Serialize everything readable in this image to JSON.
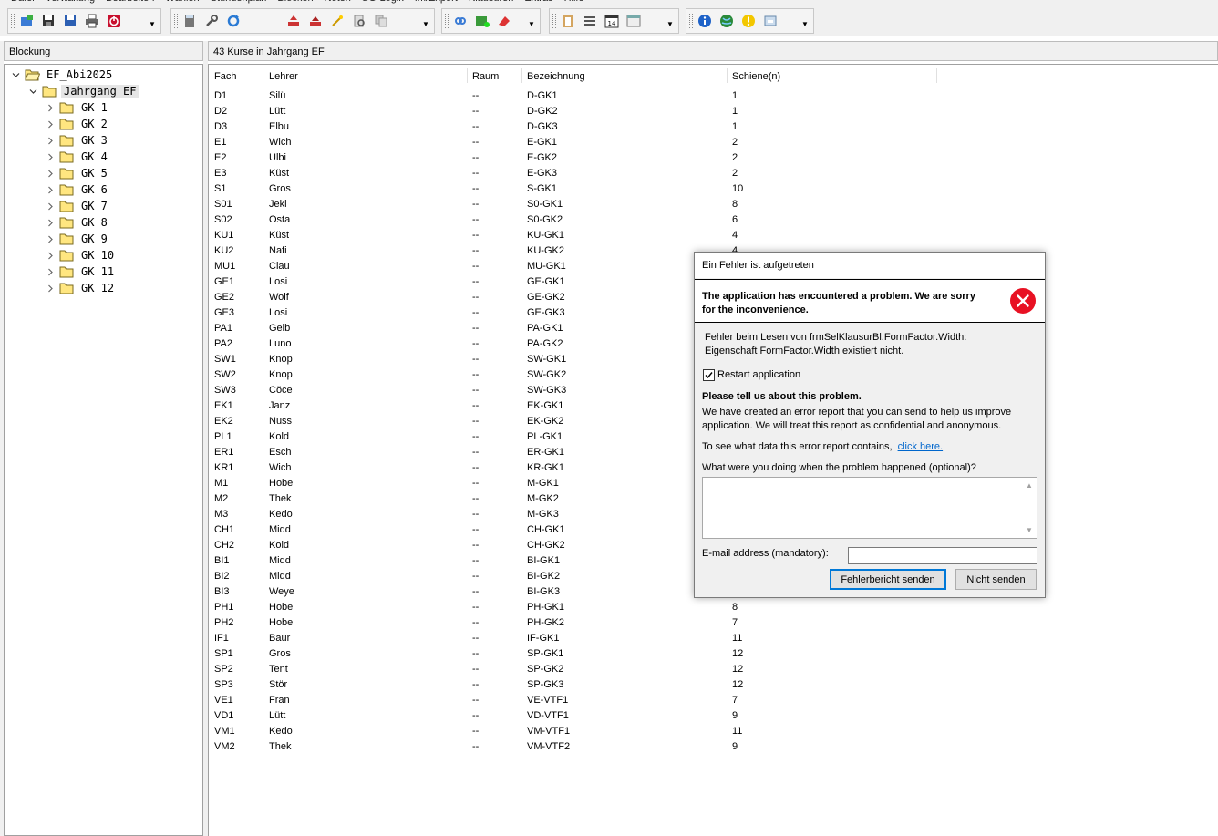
{
  "menu": [
    "Datei",
    "Verwaltung",
    "Bearbeiten",
    "Wählen",
    "Stundenplan",
    "Blocken",
    "Noten",
    "SG-Logik",
    "Im/Export",
    "Klausuren",
    "Extras",
    "Hilfe"
  ],
  "left_panel": {
    "title": "Blockung"
  },
  "right_panel": {
    "title": "43 Kurse in Jahrgang EF"
  },
  "tree": {
    "root": "EF_Abi2025",
    "group": "Jahrgang EF",
    "items": [
      "GK 1",
      "GK 2",
      "GK 3",
      "GK 4",
      "GK 5",
      "GK 6",
      "GK 7",
      "GK 8",
      "GK 9",
      "GK 10",
      "GK 11",
      "GK 12"
    ]
  },
  "table": {
    "columns": [
      "Fach",
      "Lehrer",
      "Raum",
      "Bezeichnung",
      "Schiene(n)"
    ],
    "rows": [
      [
        "D1",
        "Silü",
        "--",
        "D-GK1",
        "1"
      ],
      [
        "D2",
        "Lütt",
        "--",
        "D-GK2",
        "1"
      ],
      [
        "D3",
        "Elbu",
        "--",
        "D-GK3",
        "1"
      ],
      [
        "E1",
        "Wich",
        "--",
        "E-GK1",
        "2"
      ],
      [
        "E2",
        "Ulbi",
        "--",
        "E-GK2",
        "2"
      ],
      [
        "E3",
        "Küst",
        "--",
        "E-GK3",
        "2"
      ],
      [
        "S1",
        "Gros",
        "--",
        "S-GK1",
        "10"
      ],
      [
        "S01",
        "Jeki",
        "--",
        "S0-GK1",
        "8"
      ],
      [
        "S02",
        "Osta",
        "--",
        "S0-GK2",
        "6"
      ],
      [
        "KU1",
        "Küst",
        "--",
        "KU-GK1",
        "4"
      ],
      [
        "KU2",
        "Nafi",
        "--",
        "KU-GK2",
        "4"
      ],
      [
        "MU1",
        "Clau",
        "--",
        "MU-GK1",
        ""
      ],
      [
        "GE1",
        "Losi",
        "--",
        "GE-GK1",
        ""
      ],
      [
        "GE2",
        "Wolf",
        "--",
        "GE-GK2",
        ""
      ],
      [
        "GE3",
        "Losi",
        "--",
        "GE-GK3",
        ""
      ],
      [
        "PA1",
        "Gelb",
        "--",
        "PA-GK1",
        ""
      ],
      [
        "PA2",
        "Luno",
        "--",
        "PA-GK2",
        ""
      ],
      [
        "SW1",
        "Knop",
        "--",
        "SW-GK1",
        ""
      ],
      [
        "SW2",
        "Knop",
        "--",
        "SW-GK2",
        ""
      ],
      [
        "SW3",
        "Cöce",
        "--",
        "SW-GK3",
        ""
      ],
      [
        "EK1",
        "Janz",
        "--",
        "EK-GK1",
        ""
      ],
      [
        "EK2",
        "Nuss",
        "--",
        "EK-GK2",
        ""
      ],
      [
        "PL1",
        "Kold",
        "--",
        "PL-GK1",
        ""
      ],
      [
        "ER1",
        "Esch",
        "--",
        "ER-GK1",
        ""
      ],
      [
        "KR1",
        "Wich",
        "--",
        "KR-GK1",
        ""
      ],
      [
        "M1",
        "Hobe",
        "--",
        "M-GK1",
        ""
      ],
      [
        "M2",
        "Thek",
        "--",
        "M-GK2",
        ""
      ],
      [
        "M3",
        "Kedo",
        "--",
        "M-GK3",
        ""
      ],
      [
        "CH1",
        "Midd",
        "--",
        "CH-GK1",
        ""
      ],
      [
        "CH2",
        "Kold",
        "--",
        "CH-GK2",
        ""
      ],
      [
        "BI1",
        "Midd",
        "--",
        "BI-GK1",
        ""
      ],
      [
        "BI2",
        "Midd",
        "--",
        "BI-GK2",
        ""
      ],
      [
        "BI3",
        "Weye",
        "--",
        "BI-GK3",
        ""
      ],
      [
        "PH1",
        "Hobe",
        "--",
        "PH-GK1",
        "8"
      ],
      [
        "PH2",
        "Hobe",
        "--",
        "PH-GK2",
        "7"
      ],
      [
        "IF1",
        "Baur",
        "--",
        "IF-GK1",
        "11"
      ],
      [
        "SP1",
        "Gros",
        "--",
        "SP-GK1",
        "12"
      ],
      [
        "SP2",
        "Tent",
        "--",
        "SP-GK2",
        "12"
      ],
      [
        "SP3",
        "Stör",
        "--",
        "SP-GK3",
        "12"
      ],
      [
        "VE1",
        "Fran",
        "--",
        "VE-VTF1",
        "7"
      ],
      [
        "VD1",
        "Lütt",
        "--",
        "VD-VTF1",
        "9"
      ],
      [
        "VM1",
        "Kedo",
        "--",
        "VM-VTF1",
        "11"
      ],
      [
        "VM2",
        "Thek",
        "--",
        "VM-VTF2",
        "9"
      ]
    ]
  },
  "dialog": {
    "title": "Ein Fehler ist aufgetreten",
    "banner_line1": "The application has encountered a problem. We are sorry",
    "banner_line2": "for the inconvenience.",
    "error_line1": "Fehler beim Lesen von frmSelKlausurBl.FormFactor.Width:",
    "error_line2": "Eigenschaft FormFactor.Width existiert nicht.",
    "restart_label": "Restart application",
    "restart_checked": true,
    "tell_heading": "Please tell us about this problem.",
    "tell_line1": "We have created an error report that you can send to help us improve",
    "tell_line2": "application. We will treat this report as confidential and anonymous.",
    "see_data_text": "To see what data this error report contains,",
    "click_here": "click here.",
    "doing_label": "What were you doing when the problem happened (optional)?",
    "doing_value": "",
    "email_label": "E-mail address (mandatory):",
    "email_value": "",
    "send_button": "Fehlerbericht senden",
    "dont_send_button": "Nicht senden"
  },
  "colors": {
    "error_red": "#e81123",
    "link_blue": "#0066cc",
    "folder_yellow": "#ffe680",
    "primary_border": "#0078d7"
  }
}
